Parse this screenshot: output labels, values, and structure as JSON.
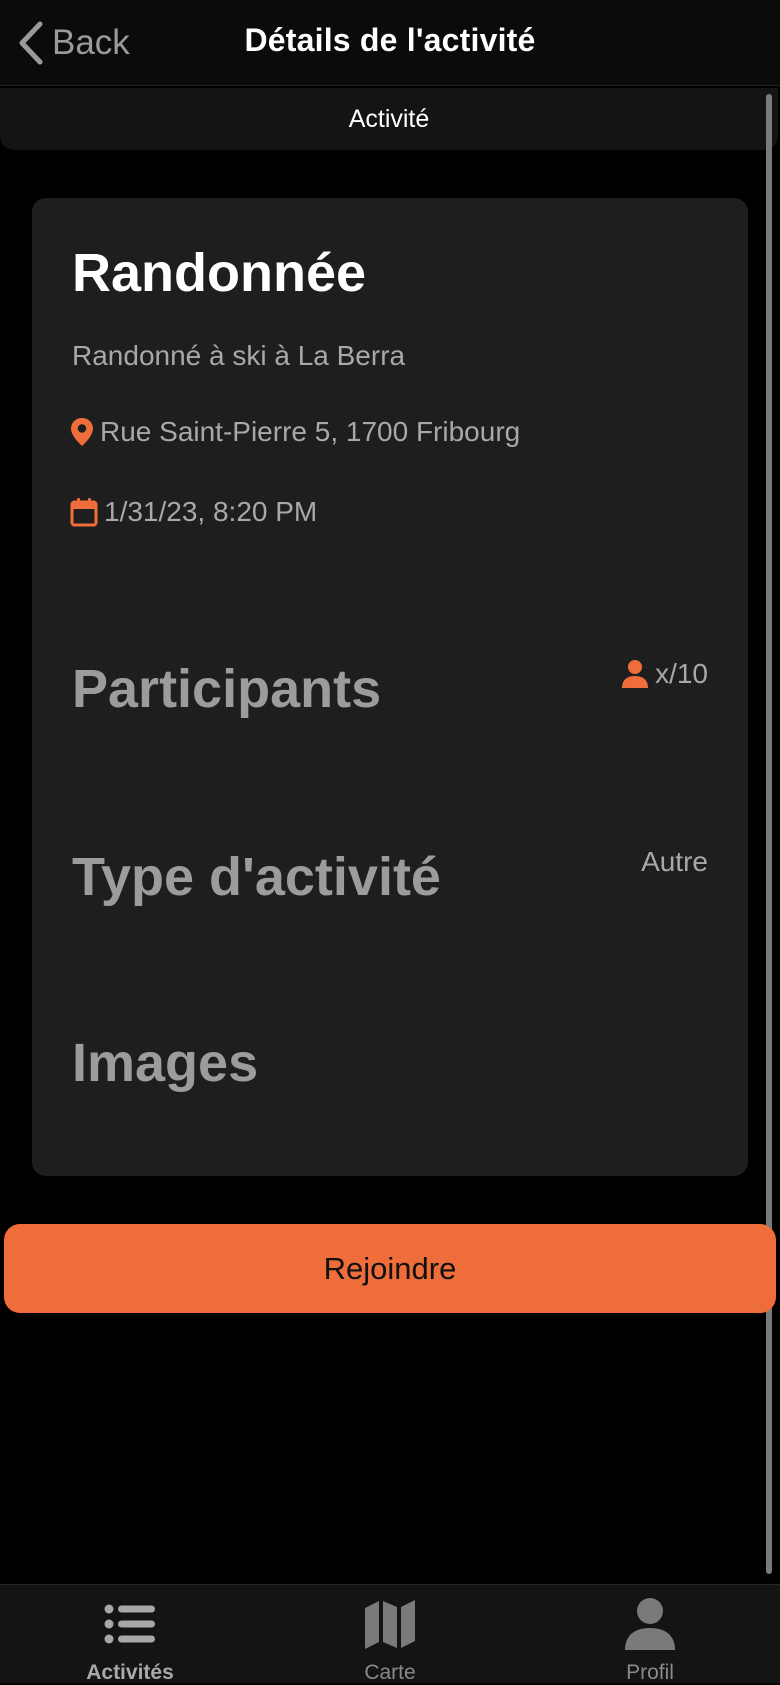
{
  "navbar": {
    "back_label": "Back",
    "title": "Détails de l'activité"
  },
  "segment": {
    "label": "Activité"
  },
  "activity": {
    "title": "Randonnée",
    "description": "Randonné à ski à La Berra",
    "address": "Rue Saint-Pierre 5, 1700 Fribourg",
    "datetime": "1/31/23, 8:20 PM",
    "participants_heading": "Participants",
    "participants_count": "x/10",
    "type_heading": "Type d'activité",
    "type_value": "Autre",
    "images_heading": "Images"
  },
  "join_button": {
    "label": "Rejoindre"
  },
  "tabbar": {
    "items": [
      {
        "label": "Activités",
        "icon": "list-icon",
        "active": true
      },
      {
        "label": "Carte",
        "icon": "map-icon",
        "active": false
      },
      {
        "label": "Profil",
        "icon": "person-icon",
        "active": false
      }
    ]
  },
  "colors": {
    "accent": "#ee6d3a",
    "background": "#000000",
    "card": "#1e1e1e"
  }
}
